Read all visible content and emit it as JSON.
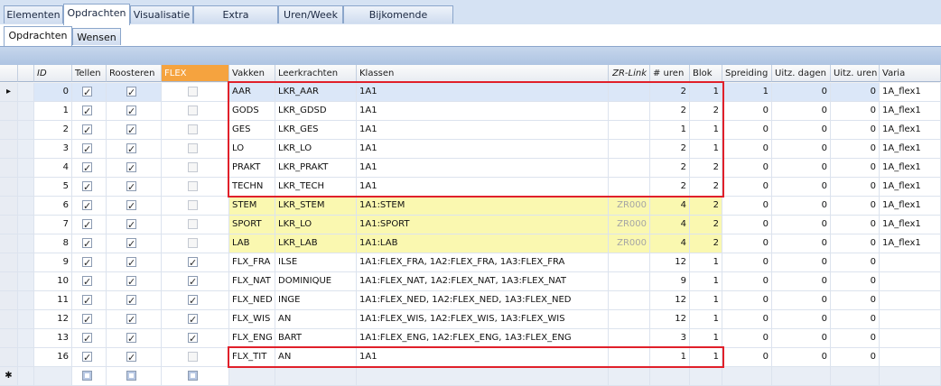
{
  "tabs": [
    "Elementen",
    "Opdrachten",
    "Visualisatie",
    "Extra spreidingen",
    "Uren/Week",
    "Bijkomende informatie"
  ],
  "subtabs": [
    "Opdrachten",
    "Wensen"
  ],
  "columns": {
    "id": "ID",
    "tellen": "Tellen",
    "roosteren": "Roosteren",
    "flex": "FLEX",
    "vakken": "Vakken",
    "leerkrachten": "Leerkrachten",
    "klassen": "Klassen",
    "zrlink": "ZR-Link",
    "uren": "# uren",
    "blok": "Blok",
    "spreiding": "Spreiding",
    "uitz_dagen": "Uitz. dagen",
    "uitz_uren": "Uitz. uren",
    "varia": "Varia"
  },
  "rows": [
    {
      "id": "0",
      "tellen": true,
      "roosteren": true,
      "flex": false,
      "vakken": "AAR",
      "leerkrachten": "LKR_AAR",
      "klassen": "1A1",
      "zrlink": "",
      "uren": "2",
      "blok": "1",
      "spreiding": "1",
      "uitz_dagen": "0",
      "uitz_uren": "0",
      "varia": "1A_flex1"
    },
    {
      "id": "1",
      "tellen": true,
      "roosteren": true,
      "flex": false,
      "vakken": "GODS",
      "leerkrachten": "LKR_GDSD",
      "klassen": "1A1",
      "zrlink": "",
      "uren": "2",
      "blok": "2",
      "spreiding": "0",
      "uitz_dagen": "0",
      "uitz_uren": "0",
      "varia": "1A_flex1"
    },
    {
      "id": "2",
      "tellen": true,
      "roosteren": true,
      "flex": false,
      "vakken": "GES",
      "leerkrachten": "LKR_GES",
      "klassen": "1A1",
      "zrlink": "",
      "uren": "1",
      "blok": "1",
      "spreiding": "0",
      "uitz_dagen": "0",
      "uitz_uren": "0",
      "varia": "1A_flex1"
    },
    {
      "id": "3",
      "tellen": true,
      "roosteren": true,
      "flex": false,
      "vakken": "LO",
      "leerkrachten": "LKR_LO",
      "klassen": "1A1",
      "zrlink": "",
      "uren": "2",
      "blok": "1",
      "spreiding": "0",
      "uitz_dagen": "0",
      "uitz_uren": "0",
      "varia": "1A_flex1"
    },
    {
      "id": "4",
      "tellen": true,
      "roosteren": true,
      "flex": false,
      "vakken": "PRAKT",
      "leerkrachten": "LKR_PRAKT",
      "klassen": "1A1",
      "zrlink": "",
      "uren": "2",
      "blok": "2",
      "spreiding": "0",
      "uitz_dagen": "0",
      "uitz_uren": "0",
      "varia": "1A_flex1"
    },
    {
      "id": "5",
      "tellen": true,
      "roosteren": true,
      "flex": false,
      "vakken": "TECHN",
      "leerkrachten": "LKR_TECH",
      "klassen": "1A1",
      "zrlink": "",
      "uren": "2",
      "blok": "2",
      "spreiding": "0",
      "uitz_dagen": "0",
      "uitz_uren": "0",
      "varia": "1A_flex1"
    },
    {
      "id": "6",
      "tellen": true,
      "roosteren": true,
      "flex": false,
      "vakken": "STEM",
      "leerkrachten": "LKR_STEM",
      "klassen": "1A1:STEM",
      "zrlink": "ZR000",
      "uren": "4",
      "blok": "2",
      "spreiding": "0",
      "uitz_dagen": "0",
      "uitz_uren": "0",
      "varia": "1A_flex1",
      "yellow": true
    },
    {
      "id": "7",
      "tellen": true,
      "roosteren": true,
      "flex": false,
      "vakken": "SPORT",
      "leerkrachten": "LKR_LO",
      "klassen": "1A1:SPORT",
      "zrlink": "ZR000",
      "uren": "4",
      "blok": "2",
      "spreiding": "0",
      "uitz_dagen": "0",
      "uitz_uren": "0",
      "varia": "1A_flex1",
      "yellow": true
    },
    {
      "id": "8",
      "tellen": true,
      "roosteren": true,
      "flex": false,
      "vakken": "LAB",
      "leerkrachten": "LKR_LAB",
      "klassen": "1A1:LAB",
      "zrlink": "ZR000",
      "uren": "4",
      "blok": "2",
      "spreiding": "0",
      "uitz_dagen": "0",
      "uitz_uren": "0",
      "varia": "1A_flex1",
      "yellow": true
    },
    {
      "id": "9",
      "tellen": true,
      "roosteren": true,
      "flex": true,
      "vakken": "FLX_FRA",
      "leerkrachten": "ILSE",
      "klassen": "1A1:FLEX_FRA,  1A2:FLEX_FRA,  1A3:FLEX_FRA",
      "zrlink": "",
      "uren": "12",
      "blok": "1",
      "spreiding": "0",
      "uitz_dagen": "0",
      "uitz_uren": "0",
      "varia": ""
    },
    {
      "id": "10",
      "tellen": true,
      "roosteren": true,
      "flex": true,
      "vakken": "FLX_NAT",
      "leerkrachten": "DOMINIQUE",
      "klassen": "1A1:FLEX_NAT,  1A2:FLEX_NAT,  1A3:FLEX_NAT",
      "zrlink": "",
      "uren": "9",
      "blok": "1",
      "spreiding": "0",
      "uitz_dagen": "0",
      "uitz_uren": "0",
      "varia": ""
    },
    {
      "id": "11",
      "tellen": true,
      "roosteren": true,
      "flex": true,
      "vakken": "FLX_NED",
      "leerkrachten": "INGE",
      "klassen": "1A1:FLEX_NED,  1A2:FLEX_NED,  1A3:FLEX_NED",
      "zrlink": "",
      "uren": "12",
      "blok": "1",
      "spreiding": "0",
      "uitz_dagen": "0",
      "uitz_uren": "0",
      "varia": ""
    },
    {
      "id": "12",
      "tellen": true,
      "roosteren": true,
      "flex": true,
      "vakken": "FLX_WIS",
      "leerkrachten": "AN",
      "klassen": "1A1:FLEX_WIS,  1A2:FLEX_WIS,  1A3:FLEX_WIS",
      "zrlink": "",
      "uren": "12",
      "blok": "1",
      "spreiding": "0",
      "uitz_dagen": "0",
      "uitz_uren": "0",
      "varia": ""
    },
    {
      "id": "13",
      "tellen": true,
      "roosteren": true,
      "flex": true,
      "vakken": "FLX_ENG",
      "leerkrachten": "BART",
      "klassen": "1A1:FLEX_ENG,  1A2:FLEX_ENG,  1A3:FLEX_ENG",
      "zrlink": "",
      "uren": "3",
      "blok": "1",
      "spreiding": "0",
      "uitz_dagen": "0",
      "uitz_uren": "0",
      "varia": ""
    },
    {
      "id": "16",
      "tellen": true,
      "roosteren": true,
      "flex": false,
      "vakken": "FLX_TIT",
      "leerkrachten": "AN",
      "klassen": "1A1",
      "zrlink": "",
      "uren": "1",
      "blok": "1",
      "spreiding": "0",
      "uitz_dagen": "0",
      "uitz_uren": "0",
      "varia": ""
    }
  ],
  "selected_row_marker": "▸",
  "new_row_marker": "✱",
  "colors": {
    "highlight": "#e0202a",
    "flex_header": "#f5a33f",
    "yellow_row": "#faf8b0",
    "selection": "#dbe7f8"
  }
}
